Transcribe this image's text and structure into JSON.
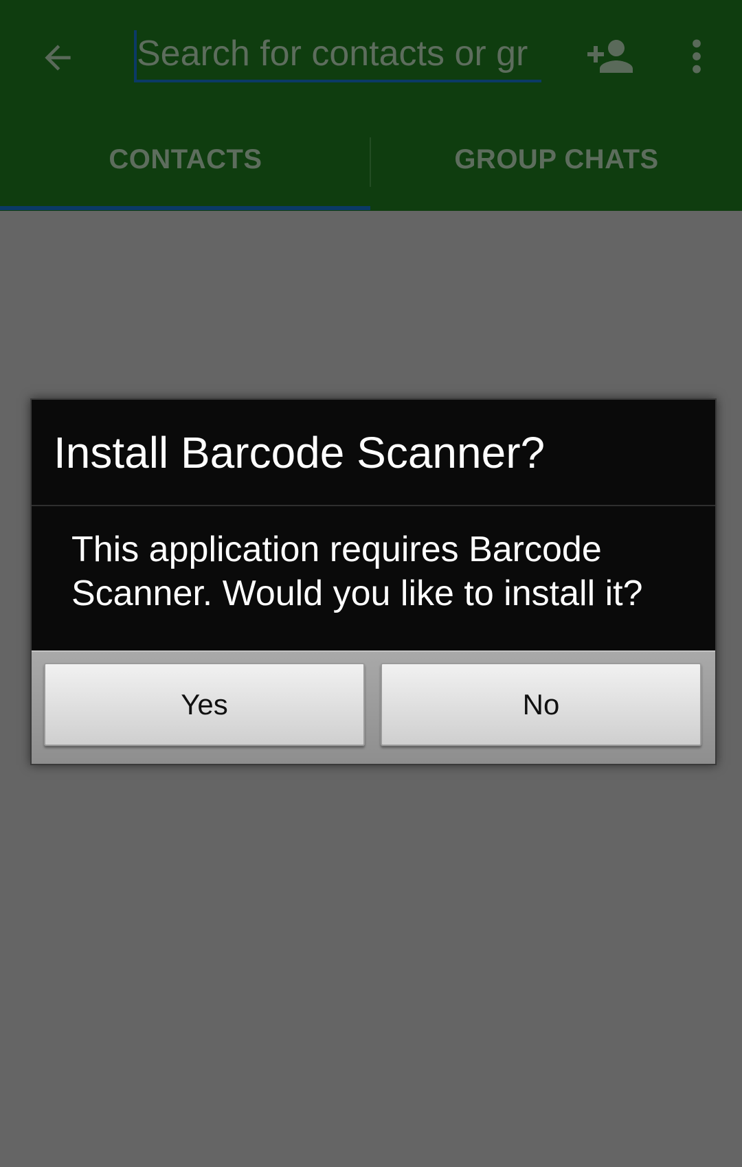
{
  "colors": {
    "appbar": "#0f3d0f",
    "scrim": "#656565",
    "accent": "#0b3a66"
  },
  "appbar": {
    "back_icon": "arrow-back-icon",
    "search": {
      "placeholder": "Search for contacts or gr",
      "value": ""
    },
    "add_contact_icon": "person-add-icon",
    "more_icon": "more-vert-icon"
  },
  "tabs": [
    {
      "label": "CONTACTS",
      "selected": true
    },
    {
      "label": "GROUP CHATS",
      "selected": false
    }
  ],
  "dialog": {
    "title": "Install Barcode Scanner?",
    "message": "This application requires Barcode Scanner. Would you like to install it?",
    "yes_label": "Yes",
    "no_label": "No"
  }
}
